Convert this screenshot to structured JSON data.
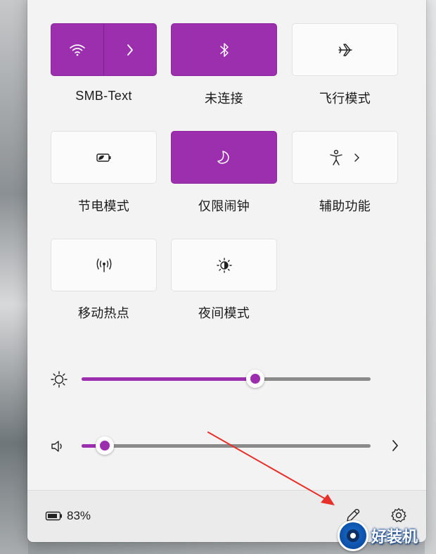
{
  "tiles": [
    {
      "id": "wifi",
      "label": "SMB-Text",
      "icon": "wifi-icon",
      "active": true,
      "has_arrow": true
    },
    {
      "id": "bluetooth",
      "label": "未连接",
      "icon": "bluetooth-icon",
      "active": true
    },
    {
      "id": "airplane",
      "label": "飞行模式",
      "icon": "airplane-icon",
      "active": false
    },
    {
      "id": "battery-saver",
      "label": "节电模式",
      "icon": "battery-saver-icon",
      "active": false
    },
    {
      "id": "focus",
      "label": "仅限闹钟",
      "icon": "moon-icon",
      "active": true
    },
    {
      "id": "accessibility",
      "label": "辅助功能",
      "icon": "accessibility-icon",
      "active": false,
      "has_arrow": true
    },
    {
      "id": "hotspot",
      "label": "移动热点",
      "icon": "hotspot-icon",
      "active": false
    },
    {
      "id": "night-light",
      "label": "夜间模式",
      "icon": "night-light-icon",
      "active": false
    }
  ],
  "brightness": {
    "icon": "brightness-icon",
    "value_percent": 60
  },
  "volume": {
    "icon": "speaker-icon",
    "value_percent": 8
  },
  "footer": {
    "battery_icon": "battery-icon",
    "battery_text": "83%",
    "edit_icon": "pencil-icon",
    "settings_icon": "gear-icon"
  },
  "watermark": {
    "text": "好装机"
  },
  "colors": {
    "accent": "#9b2fae",
    "annotation_arrow": "#e8302a"
  }
}
